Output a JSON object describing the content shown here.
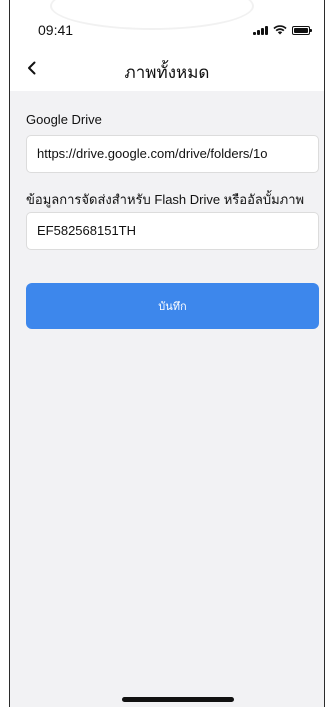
{
  "status_bar": {
    "time": "09:41"
  },
  "nav": {
    "title": "ภาพทั้งหมด",
    "back_icon": "chevron-left-icon"
  },
  "form": {
    "google_drive": {
      "label": "Google Drive",
      "value": "https://drive.google.com/drive/folders/1o"
    },
    "shipping": {
      "label": "ข้อมูลการจัดส่งสำหรับ Flash Drive หรืออัลบั้มภาพ",
      "value": "EF582568151TH"
    }
  },
  "save_button": {
    "label": "บันทึก"
  },
  "colors": {
    "accent": "#3d87ec",
    "background": "#f2f2f4"
  }
}
